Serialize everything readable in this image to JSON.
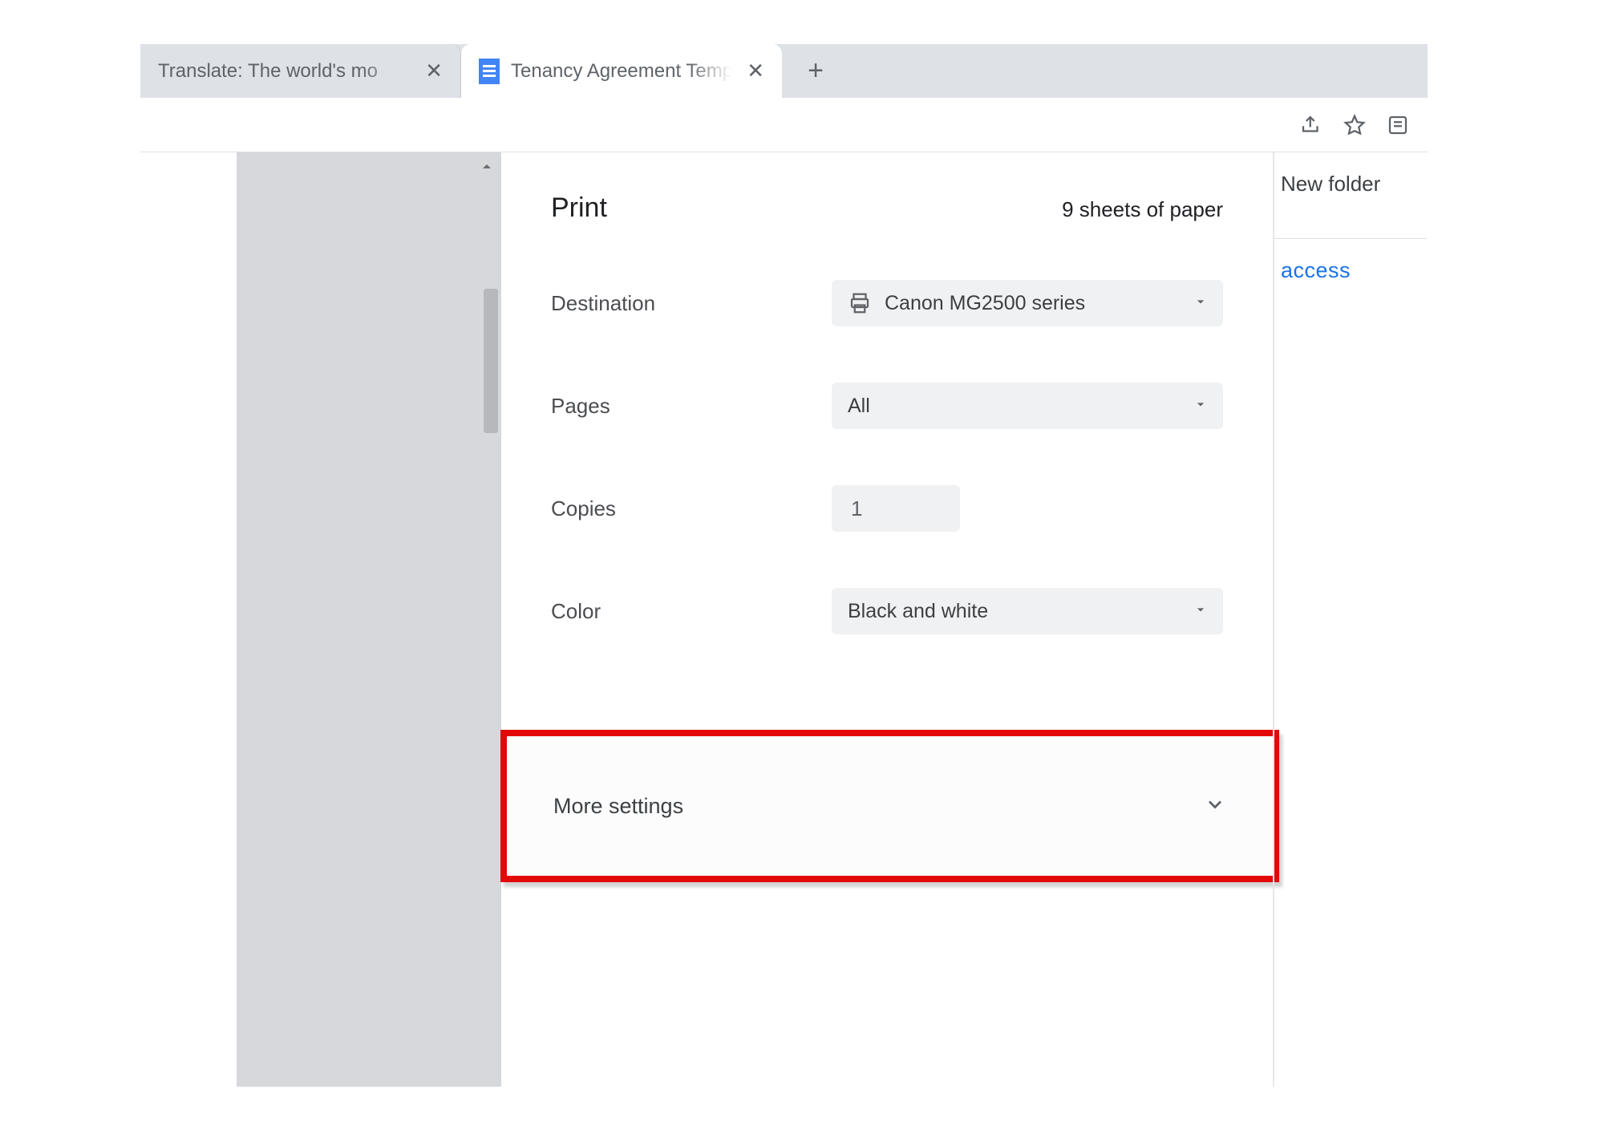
{
  "tabs": {
    "inactive_title": "Translate: The world's mo",
    "active_title": "Tenancy Agreement Template.do"
  },
  "print": {
    "title": "Print",
    "sheet_count": "9 sheets of paper",
    "destination_label": "Destination",
    "destination_value": "Canon MG2500 series",
    "pages_label": "Pages",
    "pages_value": "All",
    "copies_label": "Copies",
    "copies_value": "1",
    "color_label": "Color",
    "color_value": "Black and white",
    "more_settings_label": "More settings"
  },
  "right": {
    "new_folder": "New folder",
    "access": "access"
  }
}
